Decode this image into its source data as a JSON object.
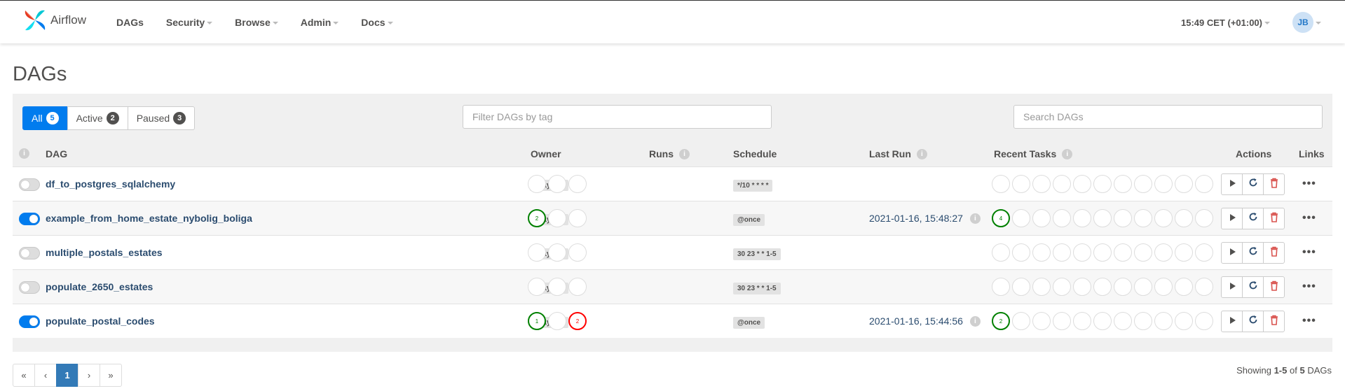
{
  "navbar": {
    "brand": "Airflow",
    "menu": [
      {
        "label": "DAGs",
        "dropdown": false
      },
      {
        "label": "Security",
        "dropdown": true
      },
      {
        "label": "Browse",
        "dropdown": true
      },
      {
        "label": "Admin",
        "dropdown": true
      },
      {
        "label": "Docs",
        "dropdown": true
      }
    ],
    "clock": "15:49 CET (+01:00)",
    "user_initials": "JB"
  },
  "page": {
    "title": "DAGs"
  },
  "filters": {
    "all_label": "All",
    "all_count": "5",
    "active_label": "Active",
    "active_count": "2",
    "paused_label": "Paused",
    "paused_count": "3",
    "tag_placeholder": "Filter DAGs by tag",
    "search_placeholder": "Search DAGs"
  },
  "table": {
    "columns": {
      "dag": "DAG",
      "owner": "Owner",
      "runs": "Runs",
      "schedule": "Schedule",
      "last_run": "Last Run",
      "recent_tasks": "Recent Tasks",
      "actions": "Actions",
      "links": "Links"
    },
    "info_glyph": "i",
    "more_glyph": "•••",
    "rows": [
      {
        "active": false,
        "name": "df_to_postgres_sqlalchemy",
        "owner": "Prayson",
        "runs": [
          {
            "state": "none",
            "count": ""
          },
          {
            "state": "none",
            "count": ""
          },
          {
            "state": "none",
            "count": ""
          }
        ],
        "schedule": "*/10 * * * *",
        "last_run": "",
        "tasks": [
          {
            "state": "none",
            "count": ""
          },
          {
            "state": "none",
            "count": ""
          },
          {
            "state": "none",
            "count": ""
          },
          {
            "state": "none",
            "count": ""
          },
          {
            "state": "none",
            "count": ""
          },
          {
            "state": "none",
            "count": ""
          },
          {
            "state": "none",
            "count": ""
          },
          {
            "state": "none",
            "count": ""
          },
          {
            "state": "none",
            "count": ""
          },
          {
            "state": "none",
            "count": ""
          },
          {
            "state": "none",
            "count": ""
          }
        ]
      },
      {
        "active": true,
        "name": "example_from_home_estate_nybolig_boliga",
        "owner": "Prayson",
        "runs": [
          {
            "state": "success",
            "count": "2"
          },
          {
            "state": "none",
            "count": ""
          },
          {
            "state": "none",
            "count": ""
          }
        ],
        "schedule": "@once",
        "last_run": "2021-01-16, 15:48:27",
        "tasks": [
          {
            "state": "success",
            "count": "4"
          },
          {
            "state": "none",
            "count": ""
          },
          {
            "state": "none",
            "count": ""
          },
          {
            "state": "none",
            "count": ""
          },
          {
            "state": "none",
            "count": ""
          },
          {
            "state": "none",
            "count": ""
          },
          {
            "state": "none",
            "count": ""
          },
          {
            "state": "none",
            "count": ""
          },
          {
            "state": "none",
            "count": ""
          },
          {
            "state": "none",
            "count": ""
          },
          {
            "state": "none",
            "count": ""
          }
        ]
      },
      {
        "active": false,
        "name": "multiple_postals_estates",
        "owner": "Prayson",
        "runs": [
          {
            "state": "none",
            "count": ""
          },
          {
            "state": "none",
            "count": ""
          },
          {
            "state": "none",
            "count": ""
          }
        ],
        "schedule": "30 23 * * 1-5",
        "last_run": "",
        "tasks": [
          {
            "state": "none",
            "count": ""
          },
          {
            "state": "none",
            "count": ""
          },
          {
            "state": "none",
            "count": ""
          },
          {
            "state": "none",
            "count": ""
          },
          {
            "state": "none",
            "count": ""
          },
          {
            "state": "none",
            "count": ""
          },
          {
            "state": "none",
            "count": ""
          },
          {
            "state": "none",
            "count": ""
          },
          {
            "state": "none",
            "count": ""
          },
          {
            "state": "none",
            "count": ""
          },
          {
            "state": "none",
            "count": ""
          }
        ]
      },
      {
        "active": false,
        "name": "populate_2650_estates",
        "owner": "Prayson",
        "runs": [
          {
            "state": "none",
            "count": ""
          },
          {
            "state": "none",
            "count": ""
          },
          {
            "state": "none",
            "count": ""
          }
        ],
        "schedule": "30 23 * * 1-5",
        "last_run": "",
        "tasks": [
          {
            "state": "none",
            "count": ""
          },
          {
            "state": "none",
            "count": ""
          },
          {
            "state": "none",
            "count": ""
          },
          {
            "state": "none",
            "count": ""
          },
          {
            "state": "none",
            "count": ""
          },
          {
            "state": "none",
            "count": ""
          },
          {
            "state": "none",
            "count": ""
          },
          {
            "state": "none",
            "count": ""
          },
          {
            "state": "none",
            "count": ""
          },
          {
            "state": "none",
            "count": ""
          },
          {
            "state": "none",
            "count": ""
          }
        ]
      },
      {
        "active": true,
        "name": "populate_postal_codes",
        "owner": "Prayson",
        "runs": [
          {
            "state": "success",
            "count": "1"
          },
          {
            "state": "none",
            "count": ""
          },
          {
            "state": "failed",
            "count": "2"
          }
        ],
        "schedule": "@once",
        "last_run": "2021-01-16, 15:44:56",
        "tasks": [
          {
            "state": "success",
            "count": "2"
          },
          {
            "state": "none",
            "count": ""
          },
          {
            "state": "none",
            "count": ""
          },
          {
            "state": "none",
            "count": ""
          },
          {
            "state": "none",
            "count": ""
          },
          {
            "state": "none",
            "count": ""
          },
          {
            "state": "none",
            "count": ""
          },
          {
            "state": "none",
            "count": ""
          },
          {
            "state": "none",
            "count": ""
          },
          {
            "state": "none",
            "count": ""
          },
          {
            "state": "none",
            "count": ""
          }
        ]
      }
    ]
  },
  "pagination": {
    "first": "«",
    "prev": "‹",
    "current": "1",
    "next": "›",
    "last": "»",
    "showing_prefix": "Showing",
    "range": "1-5",
    "of": "of",
    "total": "5",
    "suffix": "DAGs"
  },
  "colors": {
    "primary": "#017cee",
    "success": "#008000",
    "failed": "#ff0000",
    "delete": "#d9534f",
    "link": "#2b4c6f"
  },
  "icons": [
    "airflow-logo-icon",
    "caret-down-icon",
    "info-icon",
    "play-icon",
    "refresh-icon",
    "trash-icon",
    "more-icon"
  ]
}
